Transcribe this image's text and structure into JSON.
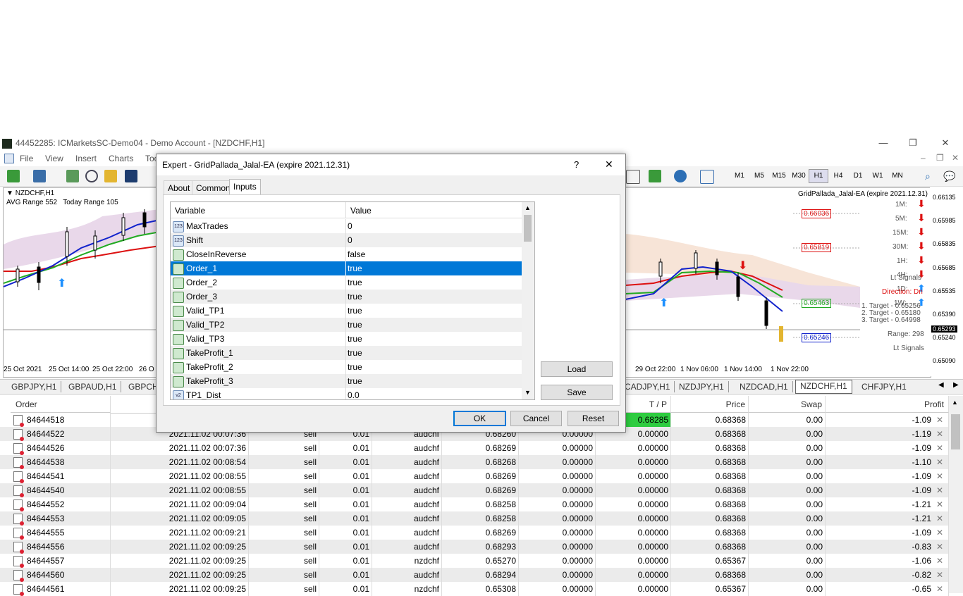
{
  "window": {
    "title": "44452285: ICMarketsSC-Demo04 - Demo Account - [NZDCHF,H1]"
  },
  "menu": [
    "File",
    "View",
    "Insert",
    "Charts",
    "Too"
  ],
  "timeframes": [
    "M1",
    "M5",
    "M15",
    "M30",
    "H1",
    "H4",
    "D1",
    "W1",
    "MN"
  ],
  "active_timeframe": "H1",
  "chart_left": {
    "symbol": "NZDCHF,H1",
    "info": "AVG Range 552   Today Range 105",
    "x_labels": [
      "25 Oct 2021",
      "25 Oct 14:00",
      "25 Oct 22:00",
      "26 O"
    ]
  },
  "chart_right": {
    "ea_label": "GridPallada_Jalal-EA (expire 2021.12.31)",
    "price_axis": [
      "0.66135",
      "0.65985",
      "0.65835",
      "0.65685",
      "0.65535",
      "0.65390",
      "0.65293",
      "0.65240",
      "0.65090"
    ],
    "levels": [
      "0.66036",
      "0.65819",
      "0.65463",
      "0.65246"
    ],
    "timeframe_signals": [
      "1M:",
      "5M:",
      "15M:",
      "30M:",
      "1H:",
      "4H:",
      "1D:",
      "1W:"
    ],
    "lt_signals": "Lt Signals",
    "direction": "Direction: Dn",
    "targets": [
      "1. Target - 0.65256",
      "2. Target - 0.65180",
      "3. Target - 0.64998"
    ],
    "range": "Range: 298",
    "x_labels": [
      "29 Oct 22:00",
      "1 Nov 06:00",
      "1 Nov 14:00",
      "1 Nov 22:00"
    ]
  },
  "symbol_tabs": [
    "GBPJPY,H1",
    "GBPAUD,H1",
    "GBPCH",
    "CADJPY,H1",
    "NZDJPY,H1",
    "NZDCAD,H1",
    "NZDCHF,H1",
    "CHFJPY,H1"
  ],
  "active_symbol_tab": "NZDCHF,H1",
  "table": {
    "headers": {
      "order": "Order",
      "tp": "T / P",
      "price": "Price",
      "swap": "Swap",
      "profit": "Profit"
    },
    "rows": [
      {
        "order": "84644518",
        "time": "",
        "type": "",
        "size": "",
        "symbol": "",
        "open": "",
        "sl": "",
        "tp": "0.68285",
        "price": "0.68368",
        "swap": "0.00",
        "profit": "-1.09"
      },
      {
        "order": "84644522",
        "time": "2021.11.02 00:07:36",
        "type": "sell",
        "size": "0.01",
        "symbol": "audchf",
        "open": "0.68260",
        "sl": "0.00000",
        "tp": "0.00000",
        "price": "0.68368",
        "swap": "0.00",
        "profit": "-1.19"
      },
      {
        "order": "84644526",
        "time": "2021.11.02 00:07:36",
        "type": "sell",
        "size": "0.01",
        "symbol": "audchf",
        "open": "0.68269",
        "sl": "0.00000",
        "tp": "0.00000",
        "price": "0.68368",
        "swap": "0.00",
        "profit": "-1.09"
      },
      {
        "order": "84644538",
        "time": "2021.11.02 00:08:54",
        "type": "sell",
        "size": "0.01",
        "symbol": "audchf",
        "open": "0.68268",
        "sl": "0.00000",
        "tp": "0.00000",
        "price": "0.68368",
        "swap": "0.00",
        "profit": "-1.10"
      },
      {
        "order": "84644541",
        "time": "2021.11.02 00:08:55",
        "type": "sell",
        "size": "0.01",
        "symbol": "audchf",
        "open": "0.68269",
        "sl": "0.00000",
        "tp": "0.00000",
        "price": "0.68368",
        "swap": "0.00",
        "profit": "-1.09"
      },
      {
        "order": "84644540",
        "time": "2021.11.02 00:08:55",
        "type": "sell",
        "size": "0.01",
        "symbol": "audchf",
        "open": "0.68269",
        "sl": "0.00000",
        "tp": "0.00000",
        "price": "0.68368",
        "swap": "0.00",
        "profit": "-1.09"
      },
      {
        "order": "84644552",
        "time": "2021.11.02 00:09:04",
        "type": "sell",
        "size": "0.01",
        "symbol": "audchf",
        "open": "0.68258",
        "sl": "0.00000",
        "tp": "0.00000",
        "price": "0.68368",
        "swap": "0.00",
        "profit": "-1.21"
      },
      {
        "order": "84644553",
        "time": "2021.11.02 00:09:05",
        "type": "sell",
        "size": "0.01",
        "symbol": "audchf",
        "open": "0.68258",
        "sl": "0.00000",
        "tp": "0.00000",
        "price": "0.68368",
        "swap": "0.00",
        "profit": "-1.21"
      },
      {
        "order": "84644555",
        "time": "2021.11.02 00:09:21",
        "type": "sell",
        "size": "0.01",
        "symbol": "audchf",
        "open": "0.68269",
        "sl": "0.00000",
        "tp": "0.00000",
        "price": "0.68368",
        "swap": "0.00",
        "profit": "-1.09"
      },
      {
        "order": "84644556",
        "time": "2021.11.02 00:09:25",
        "type": "sell",
        "size": "0.01",
        "symbol": "audchf",
        "open": "0.68293",
        "sl": "0.00000",
        "tp": "0.00000",
        "price": "0.68368",
        "swap": "0.00",
        "profit": "-0.83"
      },
      {
        "order": "84644557",
        "time": "2021.11.02 00:09:25",
        "type": "sell",
        "size": "0.01",
        "symbol": "nzdchf",
        "open": "0.65270",
        "sl": "0.00000",
        "tp": "0.00000",
        "price": "0.65367",
        "swap": "0.00",
        "profit": "-1.06"
      },
      {
        "order": "84644560",
        "time": "2021.11.02 00:09:25",
        "type": "sell",
        "size": "0.01",
        "symbol": "audchf",
        "open": "0.68294",
        "sl": "0.00000",
        "tp": "0.00000",
        "price": "0.68368",
        "swap": "0.00",
        "profit": "-0.82"
      },
      {
        "order": "84644561",
        "time": "2021.11.02 00:09:25",
        "type": "sell",
        "size": "0.01",
        "symbol": "nzdchf",
        "open": "0.65308",
        "sl": "0.00000",
        "tp": "0.00000",
        "price": "0.65367",
        "swap": "0.00",
        "profit": "-0.65"
      }
    ]
  },
  "dialog": {
    "title": "Expert - GridPallada_Jalal-EA (expire 2021.12.31)",
    "help": "?",
    "close": "✕",
    "tabs": [
      "About",
      "Common",
      "Inputs"
    ],
    "active_tab": "Inputs",
    "columns": {
      "variable": "Variable",
      "value": "Value"
    },
    "inputs": [
      {
        "name": "MaxTrades",
        "value": "0",
        "icon": "123"
      },
      {
        "name": "Shift",
        "value": "0",
        "icon": "123"
      },
      {
        "name": "CloseInReverse",
        "value": "false",
        "icon": "bool"
      },
      {
        "name": "Order_1",
        "value": "true",
        "icon": "bool"
      },
      {
        "name": "Order_2",
        "value": "true",
        "icon": "bool"
      },
      {
        "name": "Order_3",
        "value": "true",
        "icon": "bool"
      },
      {
        "name": "Valid_TP1",
        "value": "true",
        "icon": "bool"
      },
      {
        "name": "Valid_TP2",
        "value": "true",
        "icon": "bool"
      },
      {
        "name": "Valid_TP3",
        "value": "true",
        "icon": "bool"
      },
      {
        "name": "TakeProfit_1",
        "value": "true",
        "icon": "bool"
      },
      {
        "name": "TakeProfit_2",
        "value": "true",
        "icon": "bool"
      },
      {
        "name": "TakeProfit_3",
        "value": "true",
        "icon": "bool"
      },
      {
        "name": "TP1_Dist",
        "value": "0.0",
        "icon": "v2"
      }
    ],
    "selected_input": "Order_1",
    "buttons": {
      "load": "Load",
      "save": "Save",
      "ok": "OK",
      "cancel": "Cancel",
      "reset": "Reset"
    }
  },
  "colors": {
    "selection": "#0078d7",
    "tp_highlight": "#2ecc40",
    "accent": "#0078d7"
  }
}
